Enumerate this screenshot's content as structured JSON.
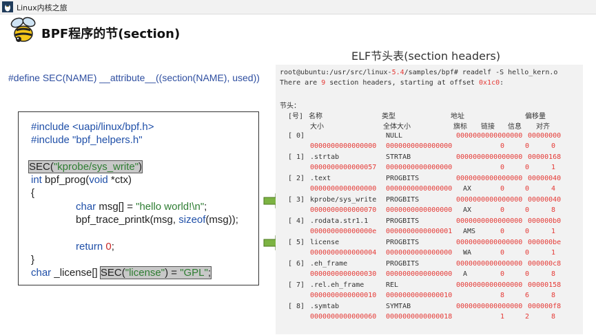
{
  "header": {
    "brand_name": "Linux内核之旅",
    "slide_title": "BPF程序的节(section)",
    "elf_caption": "ELF节头表(section headers)"
  },
  "define_line": "#define SEC(NAME) __attribute__((section(NAME), used))",
  "code": {
    "line1_kw": "#include ",
    "line1_str": "<uapi/linux/bpf.h>",
    "line2_kw": "#include ",
    "line2_str": "\"bpf_helpers.h\"",
    "line3_sec": "SEC(",
    "line3_str": "\"kprobe/sys_write\"",
    "line3_close": ")",
    "line4_kw": "int",
    "line4_rest": " bpf_prog(",
    "line4_kw2": "void",
    "line4_rest2": " *ctx)",
    "line5": "{",
    "line6_kw": "char",
    "line6_rest": " msg[] = ",
    "line6_str": "\"hello world!\\n\"",
    "line6_end": ";",
    "line7_a": "bpf_trace_printk(msg, ",
    "line7_kw": "sizeof",
    "line7_b": "(msg));",
    "line8_kw": "return",
    "line8_sp": " ",
    "line8_num": "0",
    "line8_end": ";",
    "line9": "}",
    "line10_kw": "char",
    "line10_rest": " _license[] ",
    "line10_sec": "SEC(",
    "line10_str1": "\"license\"",
    "line10_mid": ") = ",
    "line10_str2": "\"GPL\"",
    "line10_end": ";"
  },
  "terminal": {
    "cmd_prefix": "root@ubuntu:/usr/src/linux-",
    "cmd_version": "5.4",
    "cmd_suffix": "/samples/bpf# readelf -S hello_kern.o",
    "info_a": "There are ",
    "info_count": "9",
    "info_b": " section headers, starting at offset ",
    "info_offset": "0x1c0",
    "info_c": ":",
    "section_heading": "节头：",
    "col_num": "[号]",
    "col_name": "名称",
    "col_type": "类型",
    "col_addr": "地址",
    "col_offset": "偏移量",
    "col_size": "大小",
    "col_entsize": "全体大小",
    "col_flags": "旗标",
    "col_link": "链接",
    "col_info": "信息",
    "col_align": "对齐"
  },
  "sections": [
    {
      "idx": "[ 0]",
      "name": "",
      "type": "NULL",
      "addr": "0000000000000000",
      "offset": "00000000",
      "size": "0000000000000000",
      "entsize": "0000000000000000",
      "flags": "",
      "link": "0",
      "info": "0",
      "align": "0"
    },
    {
      "idx": "[ 1]",
      "name": ".strtab",
      "type": "STRTAB",
      "addr": "0000000000000000",
      "offset": "00000168",
      "size": "0000000000000057",
      "entsize": "0000000000000000",
      "flags": "",
      "link": "0",
      "info": "0",
      "align": "1"
    },
    {
      "idx": "[ 2]",
      "name": ".text",
      "type": "PROGBITS",
      "addr": "0000000000000000",
      "offset": "00000040",
      "size": "0000000000000000",
      "entsize": "0000000000000000",
      "flags": "AX",
      "link": "0",
      "info": "0",
      "align": "4"
    },
    {
      "idx": "[ 3]",
      "name": "kprobe/sys_write",
      "type": "PROGBITS",
      "addr": "0000000000000000",
      "offset": "00000040",
      "size": "0000000000000070",
      "entsize": "0000000000000000",
      "flags": "AX",
      "link": "0",
      "info": "0",
      "align": "8"
    },
    {
      "idx": "[ 4]",
      "name": ".rodata.str1.1",
      "type": "PROGBITS",
      "addr": "0000000000000000",
      "offset": "000000b0",
      "size": "000000000000000e",
      "entsize": "0000000000000001",
      "flags": "AMS",
      "link": "0",
      "info": "0",
      "align": "1"
    },
    {
      "idx": "[ 5]",
      "name": "license",
      "type": "PROGBITS",
      "addr": "0000000000000000",
      "offset": "000000be",
      "size": "0000000000000004",
      "entsize": "0000000000000000",
      "flags": "WA",
      "link": "0",
      "info": "0",
      "align": "1"
    },
    {
      "idx": "[ 6]",
      "name": ".eh_frame",
      "type": "PROGBITS",
      "addr": "0000000000000000",
      "offset": "000000c8",
      "size": "0000000000000030",
      "entsize": "0000000000000000",
      "flags": "A",
      "link": "0",
      "info": "0",
      "align": "8"
    },
    {
      "idx": "[ 7]",
      "name": ".rel.eh_frame",
      "type": "REL",
      "addr": "0000000000000000",
      "offset": "00000158",
      "size": "0000000000000010",
      "entsize": "0000000000000010",
      "flags": "",
      "link": "8",
      "info": "6",
      "align": "8"
    },
    {
      "idx": "[ 8]",
      "name": ".symtab",
      "type": "SYMTAB",
      "addr": "0000000000000000",
      "offset": "000000f8",
      "size": "0000000000000060",
      "entsize": "0000000000000018",
      "flags": "",
      "link": "1",
      "info": "2",
      "align": "8"
    }
  ],
  "colors": {
    "accent_red": "#e53935",
    "keyword_blue": "#1f4fa8",
    "string_green": "#2e7d32",
    "arrow_green": "#7cb342"
  },
  "icons": [
    "penguin-logo-icon",
    "bee-icon",
    "arrow-right-icon"
  ]
}
